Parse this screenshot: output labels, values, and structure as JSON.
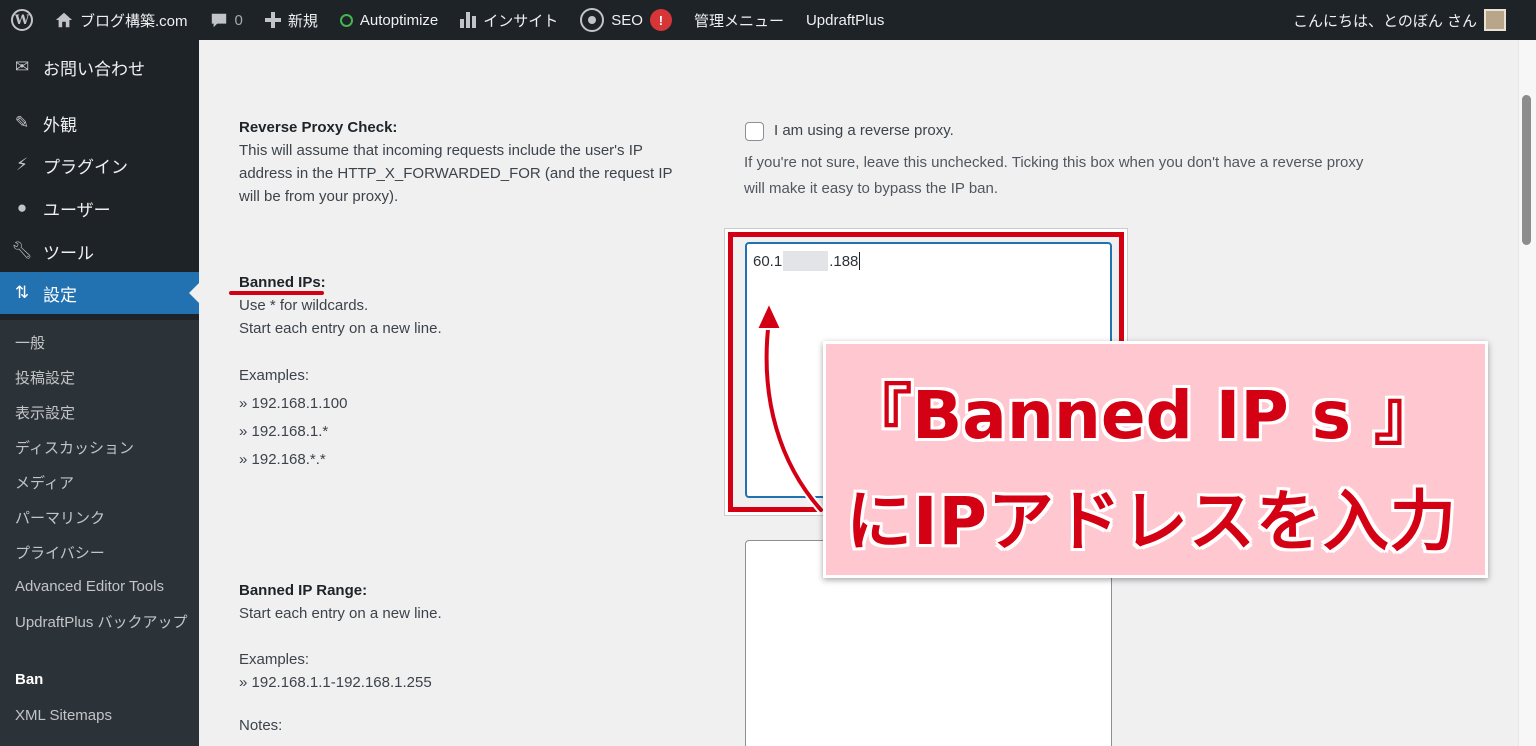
{
  "adminbar": {
    "site_name": "ブログ構築.com",
    "comments_count": "0",
    "new_label": "新規",
    "autoptimize_label": "Autoptimize",
    "insight_label": "インサイト",
    "seo_label": "SEO",
    "seo_alert": "!",
    "admin_menu_label": "管理メニュー",
    "updraft_label": "UpdraftPlus",
    "greeting": "こんにちは、とのぼん さん"
  },
  "sidebar": {
    "items": [
      {
        "label": "お問い合わせ",
        "icon": "mail-icon"
      },
      {
        "label": "外観",
        "icon": "brush-icon"
      },
      {
        "label": "プラグイン",
        "icon": "plug-icon"
      },
      {
        "label": "ユーザー",
        "icon": "user-icon"
      },
      {
        "label": "ツール",
        "icon": "wrench-icon"
      },
      {
        "label": "設定",
        "icon": "settings-icon"
      }
    ],
    "submenu": [
      "一般",
      "投稿設定",
      "表示設定",
      "ディスカッション",
      "メディア",
      "パーマリンク",
      "プライバシー",
      "Advanced Editor Tools",
      "UpdraftPlus バックアップ",
      "Ban",
      "XML Sitemaps"
    ]
  },
  "form": {
    "reverse_proxy": {
      "title": "Reverse Proxy Check:",
      "desc_lines": [
        "This will assume that incoming requests include the user's IP",
        "address in the HTTP_X_FORWARDED_FOR (and the request IP",
        "will be from your proxy)."
      ],
      "checkbox_label": "I am using a reverse proxy.",
      "help_lines": [
        "If you're not sure, leave this unchecked. Ticking this box when you don't have a reverse proxy",
        "will make it easy to bypass the IP ban."
      ]
    },
    "banned_ips": {
      "title": "Banned IPs:",
      "desc_lines": [
        "Use * for wildcards.",
        "Start each entry on a new line."
      ],
      "examples_title": "Examples:",
      "examples": [
        "» 192.168.1.100",
        "» 192.168.1.*",
        "» 192.168.*.*"
      ],
      "value_start": "60.1",
      "value_end": ".188"
    },
    "banned_range": {
      "title": "Banned IP Range:",
      "desc_lines": [
        "Start each entry on a new line."
      ],
      "examples_title": "Examples:",
      "examples": [
        "» 192.168.1.1-192.168.1.255"
      ],
      "notes_title": "Notes:"
    }
  },
  "annotation": {
    "line1": "『Banned IP s 』",
    "line2": "にIPアドレスを入力",
    "color": "#d40013"
  }
}
